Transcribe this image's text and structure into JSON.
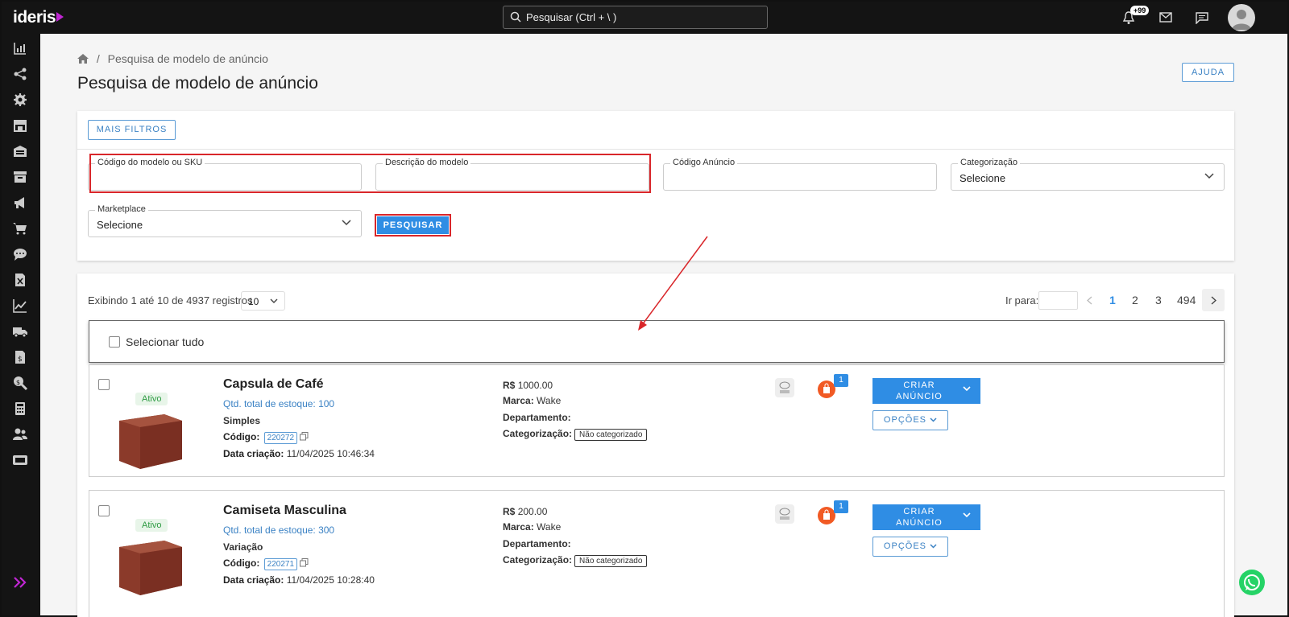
{
  "header": {
    "logo": "ideris",
    "search_placeholder": "Pesquisar (Ctrl + \\ )",
    "notifications_badge": "+99"
  },
  "breadcrumb": {
    "current": "Pesquisa de modelo de anúncio"
  },
  "page_title": "Pesquisa de modelo de anúncio",
  "help_label": "AJUDA",
  "filters": {
    "more_filters": "MAIS FILTROS",
    "sku_label": "Código do modelo ou SKU",
    "description_label": "Descrição do modelo",
    "ad_code_label": "Código Anúncio",
    "categorization_label": "Categorização",
    "categorization_value": "Selecione",
    "marketplace_label": "Marketplace",
    "marketplace_value": "Selecione",
    "search_button": "PESQUISAR"
  },
  "results": {
    "summary": "Exibindo 1 até 10 de 4937 registros",
    "per_page": "10",
    "goto_label": "Ir para:",
    "pages": [
      "1",
      "2",
      "3",
      "494"
    ],
    "select_all": "Selecionar tudo"
  },
  "products": [
    {
      "status": "Ativo",
      "title": "Capsula de Café",
      "stock": "Qtd. total de estoque: 100",
      "type": "Simples",
      "code_label": "Código:",
      "code": "220272",
      "date_label": "Data criação:",
      "date": "11/04/2025 10:46:34",
      "price_label": "R$",
      "price": "1000.00",
      "brand_label": "Marca:",
      "brand": "Wake",
      "department_label": "Departamento:",
      "categorization_label": "Categorização:",
      "categorization": "Não categorizado",
      "count": "1",
      "create_button": "CRIAR ANÚNCIO",
      "options_button": "OPÇÕES"
    },
    {
      "status": "Ativo",
      "title": "Camiseta Masculina",
      "stock": "Qtd. total de estoque: 300",
      "type": "Variação",
      "code_label": "Código:",
      "code": "220271",
      "date_label": "Data criação:",
      "date": "11/04/2025 10:28:40",
      "price_label": "R$",
      "price": "200.00",
      "brand_label": "Marca:",
      "brand": "Wake",
      "department_label": "Departamento:",
      "categorization_label": "Categorização:",
      "categorization": "Não categorizado",
      "count": "1",
      "create_button": "CRIAR ANÚNCIO",
      "options_button": "OPÇÕES"
    }
  ],
  "colors": {
    "accent": "#2f8de4",
    "highlight": "#d9262a",
    "sidebar": "#141414"
  }
}
